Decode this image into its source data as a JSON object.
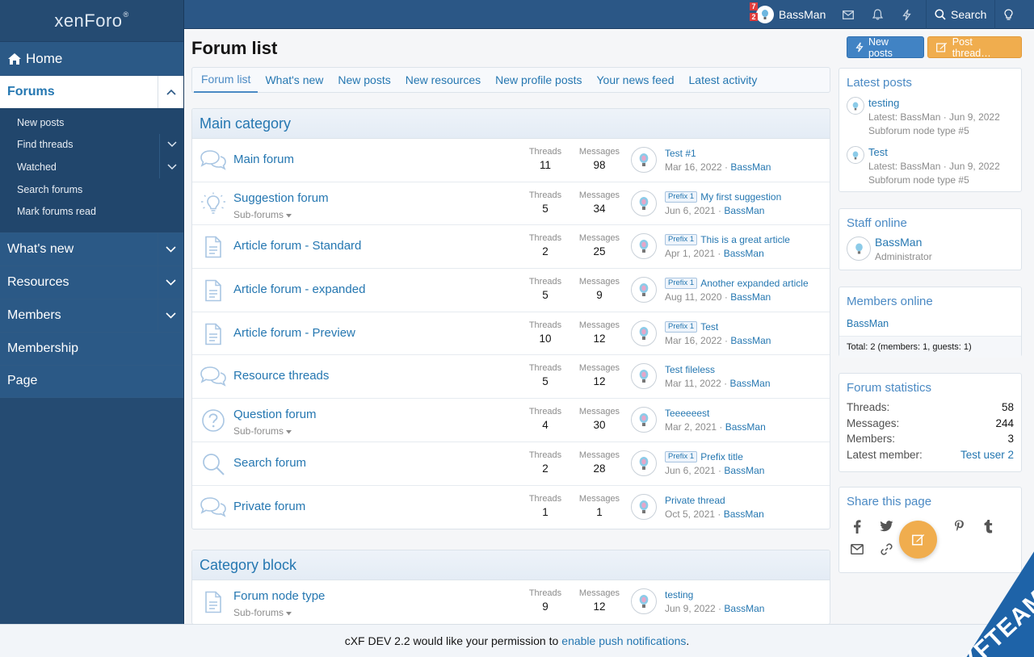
{
  "logo": {
    "text": "xenForo",
    "mark": "®"
  },
  "sidebar": {
    "home": "Home",
    "forums": "Forums",
    "sub_items": [
      {
        "label": "New posts"
      },
      {
        "label": "Find threads"
      },
      {
        "label": "Watched"
      },
      {
        "label": "Search forums"
      },
      {
        "label": "Mark forums read"
      }
    ],
    "main_items": [
      {
        "label": "What's new"
      },
      {
        "label": "Resources"
      },
      {
        "label": "Members"
      },
      {
        "label": "Membership"
      },
      {
        "label": "Page"
      }
    ]
  },
  "topbar": {
    "username": "BassMan",
    "badge_conversations": "7",
    "badge_alerts": "2",
    "search_label": "Search"
  },
  "page": {
    "title": "Forum list",
    "new_posts_btn": "New posts",
    "post_thread_btn": "Post thread…"
  },
  "tabs": [
    "Forum list",
    "What's new",
    "New posts",
    "New resources",
    "New profile posts",
    "Your news feed",
    "Latest activity"
  ],
  "labels": {
    "threads": "Threads",
    "messages": "Messages",
    "subforums": "Sub-forums"
  },
  "categories": [
    {
      "title": "Main category",
      "nodes": [
        {
          "title": "Main forum",
          "icon": "chat-bubbles-icon",
          "subforums": false,
          "threads": "11",
          "messages": "98",
          "last_prefix": "",
          "last_title": "Test #1",
          "last_date": "Mar 16, 2022",
          "last_user": "BassMan"
        },
        {
          "title": "Suggestion forum",
          "icon": "lightbulb-icon",
          "subforums": true,
          "threads": "5",
          "messages": "34",
          "last_prefix": "Prefix 1",
          "last_title": "My first suggestion",
          "last_date": "Jun 6, 2021",
          "last_user": "BassMan"
        },
        {
          "title": "Article forum - Standard",
          "icon": "document-icon",
          "subforums": false,
          "threads": "2",
          "messages": "25",
          "last_prefix": "Prefix 1",
          "last_title": "This is a great article",
          "last_date": "Apr 1, 2021",
          "last_user": "BassMan"
        },
        {
          "title": "Article forum - expanded",
          "icon": "document-icon",
          "subforums": false,
          "threads": "5",
          "messages": "9",
          "last_prefix": "Prefix 1",
          "last_title": "Another expanded article",
          "last_date": "Aug 11, 2020",
          "last_user": "BassMan"
        },
        {
          "title": "Article forum - Preview",
          "icon": "document-icon",
          "subforums": false,
          "threads": "10",
          "messages": "12",
          "last_prefix": "Prefix 1",
          "last_title": "Test",
          "last_date": "Mar 16, 2022",
          "last_user": "BassMan"
        },
        {
          "title": "Resource threads",
          "icon": "chat-bubbles-icon",
          "subforums": false,
          "threads": "5",
          "messages": "12",
          "last_prefix": "",
          "last_title": "Test fileless",
          "last_date": "Mar 11, 2022",
          "last_user": "BassMan"
        },
        {
          "title": "Question forum",
          "icon": "question-icon",
          "subforums": true,
          "threads": "4",
          "messages": "30",
          "last_prefix": "",
          "last_title": "Teeeeeest",
          "last_date": "Mar 2, 2021",
          "last_user": "BassMan"
        },
        {
          "title": "Search forum",
          "icon": "magnifier-icon",
          "subforums": false,
          "threads": "2",
          "messages": "28",
          "last_prefix": "Prefix 1",
          "last_title": "Prefix title",
          "last_date": "Jun 6, 2021",
          "last_user": "BassMan"
        },
        {
          "title": "Private forum",
          "icon": "chat-bubbles-icon",
          "subforums": false,
          "threads": "1",
          "messages": "1",
          "last_prefix": "",
          "last_title": "Private thread",
          "last_date": "Oct 5, 2021",
          "last_user": "BassMan"
        }
      ]
    },
    {
      "title": "Category block",
      "nodes": [
        {
          "title": "Forum node type",
          "icon": "document-icon",
          "subforums": true,
          "threads": "9",
          "messages": "12",
          "last_prefix": "",
          "last_title": "testing",
          "last_date": "Jun 9, 2022",
          "last_user": "BassMan"
        }
      ]
    }
  ],
  "latest_posts": {
    "title": "Latest posts",
    "items": [
      {
        "title": "testing",
        "meta": "Latest: BassMan · Jun 9, 2022",
        "forum": "Subforum node type #5"
      },
      {
        "title": "Test",
        "meta": "Latest: BassMan · Jun 9, 2022",
        "forum": "Subforum node type #5"
      }
    ]
  },
  "staff_online": {
    "title": "Staff online",
    "name": "BassMan",
    "role": "Administrator"
  },
  "members_online": {
    "title": "Members online",
    "list": "BassMan",
    "total": "Total: 2 (members: 1, guests: 1)"
  },
  "forum_stats": {
    "title": "Forum statistics",
    "rows": [
      {
        "label": "Threads:",
        "value": "58"
      },
      {
        "label": "Messages:",
        "value": "244"
      },
      {
        "label": "Members:",
        "value": "3"
      },
      {
        "label": "Latest member:",
        "value": "Test user 2"
      }
    ]
  },
  "share": {
    "title": "Share this page"
  },
  "push": {
    "text": "cXF DEV 2.2 would like your permission to",
    "link": "enable push notifications",
    "suffix": "."
  },
  "watermark": "XFTEAM.NET",
  "colors": {
    "accent": "#2577b1",
    "nav_bg": "#254b72",
    "cta": "#f0ad4e"
  }
}
